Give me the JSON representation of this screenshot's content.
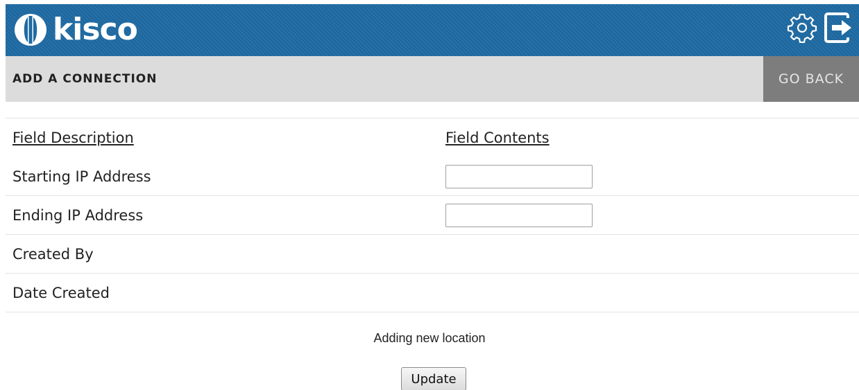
{
  "header": {
    "logo_text": "kisco",
    "brand_color": "#1e6aa3",
    "icons": [
      "gear-icon",
      "logout-icon"
    ]
  },
  "titlebar": {
    "title": "ADD A CONNECTION",
    "go_back_label": "GO BACK"
  },
  "table": {
    "col_description": "Field Description",
    "col_contents": "Field Contents",
    "rows": [
      {
        "label": "Starting IP Address",
        "value": "",
        "placeholder": ""
      },
      {
        "label": "Ending IP Address",
        "value": "",
        "placeholder": ""
      },
      {
        "label": "Created By",
        "value": ""
      },
      {
        "label": "Date Created",
        "value": ""
      }
    ]
  },
  "status_text": "Adding new location",
  "update_label": "Update"
}
